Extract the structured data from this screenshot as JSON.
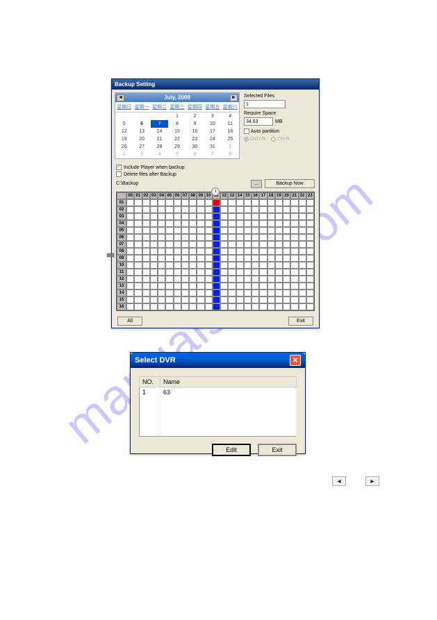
{
  "watermark": "manualslive.com",
  "window1": {
    "title": "Backup Setting",
    "calendar": {
      "month_label": "July, 2009",
      "dow": [
        "星期日",
        "星期一",
        "星期二",
        "星期三",
        "星期四",
        "星期五",
        "星期六"
      ],
      "rows": [
        [
          {
            "d": "",
            "dim": true
          },
          {
            "d": "",
            "dim": true
          },
          {
            "d": "",
            "dim": true
          },
          {
            "d": "1"
          },
          {
            "d": "2"
          },
          {
            "d": "3"
          },
          {
            "d": "4"
          }
        ],
        [
          {
            "d": "5"
          },
          {
            "d": "6",
            "bold": true
          },
          {
            "d": "7",
            "sel": true
          },
          {
            "d": "8"
          },
          {
            "d": "9"
          },
          {
            "d": "10"
          },
          {
            "d": "11"
          }
        ],
        [
          {
            "d": "12"
          },
          {
            "d": "13"
          },
          {
            "d": "14"
          },
          {
            "d": "15"
          },
          {
            "d": "16"
          },
          {
            "d": "17"
          },
          {
            "d": "18"
          }
        ],
        [
          {
            "d": "19"
          },
          {
            "d": "20"
          },
          {
            "d": "21"
          },
          {
            "d": "22"
          },
          {
            "d": "23"
          },
          {
            "d": "24"
          },
          {
            "d": "25"
          }
        ],
        [
          {
            "d": "26"
          },
          {
            "d": "27"
          },
          {
            "d": "28"
          },
          {
            "d": "29"
          },
          {
            "d": "30"
          },
          {
            "d": "31"
          },
          {
            "d": "1",
            "dim": true
          }
        ],
        [
          {
            "d": "2",
            "dim": true
          },
          {
            "d": "3",
            "dim": true
          },
          {
            "d": "4",
            "dim": true
          },
          {
            "d": "5",
            "dim": true
          },
          {
            "d": "6",
            "dim": true
          },
          {
            "d": "7",
            "dim": true
          },
          {
            "d": "8",
            "dim": true
          }
        ]
      ]
    },
    "selected_files_label": "Selected Files",
    "selected_files_value": "1",
    "require_space_label": "Require Space",
    "require_space_value": "34.63",
    "require_space_unit": "MB",
    "auto_partition_label": "Auto partition",
    "dvd_r_label": "DVD-R",
    "cd_r_label": "CD-R",
    "include_player_label": "Include Player when backup",
    "delete_files_label": "Delete files after Backup",
    "backup_path": "C:\\Backup",
    "browse_label": "...",
    "backup_now_label": "Backup Now",
    "hours": [
      "00",
      "01",
      "02",
      "03",
      "04",
      "05",
      "06",
      "07",
      "08",
      "09",
      "10",
      "11",
      "12",
      "13",
      "14",
      "15",
      "16",
      "17",
      "18",
      "19",
      "20",
      "21",
      "22",
      "23"
    ],
    "channels": [
      "01",
      "02",
      "03",
      "04",
      "05",
      "06",
      "07",
      "08",
      "09",
      "10",
      "11",
      "12",
      "13",
      "14",
      "15",
      "16"
    ],
    "all_btn": "All",
    "exit_btn": "Exit"
  },
  "window2": {
    "title": "Select DVR",
    "col_no": "NO.",
    "col_name": "Name",
    "rows": [
      {
        "no": "1",
        "name": "63"
      }
    ],
    "edit_btn": "Edit",
    "exit_btn": "Exit"
  },
  "nav": {
    "prev": "◄",
    "next": "►"
  }
}
